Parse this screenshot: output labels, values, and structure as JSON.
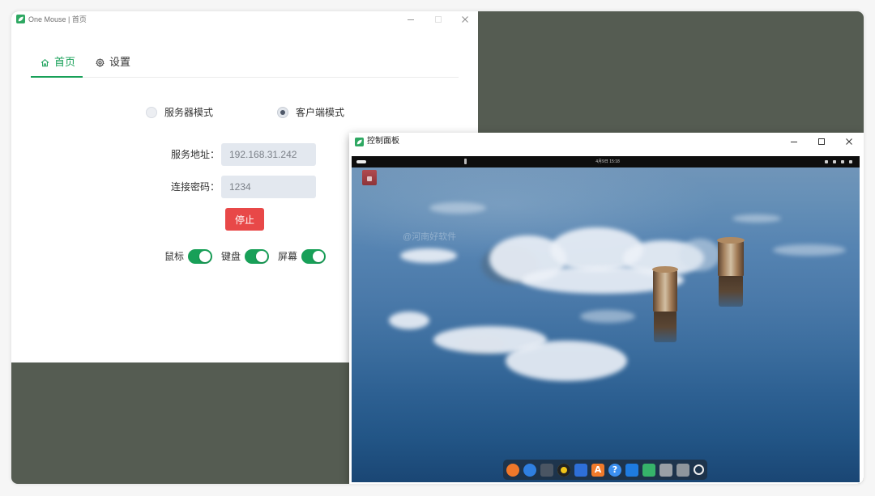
{
  "colors": {
    "accent": "#18a058",
    "danger": "#e84848",
    "desktop_background": "#555c52",
    "input_background": "#e3e8ef"
  },
  "main_window": {
    "title": "One Mouse | 首页",
    "app_icon": "one-mouse-leaf-icon",
    "controls": [
      "minimize-icon",
      "maximize-icon",
      "close-icon"
    ],
    "tabs": [
      {
        "label": "首页",
        "icon": "home-icon",
        "active": true
      },
      {
        "label": "设置",
        "icon": "gear-icon",
        "active": false
      }
    ],
    "mode": {
      "options": [
        {
          "label": "服务器模式",
          "selected": false
        },
        {
          "label": "客户端模式",
          "selected": true
        }
      ]
    },
    "form": {
      "server_address": {
        "label": "服务地址：",
        "value": "192.168.31.242"
      },
      "password": {
        "label": "连接密码：",
        "value": "1234"
      }
    },
    "stop_button": "停止",
    "toggles": [
      {
        "label": "鼠标",
        "on": true
      },
      {
        "label": "键盘",
        "on": true
      },
      {
        "label": "屏幕",
        "on": true
      }
    ]
  },
  "control_panel": {
    "title": "控制面板",
    "app_icon": "one-mouse-leaf-icon",
    "controls": [
      "minimize-icon",
      "maximize-icon",
      "close-icon"
    ],
    "remote_desktop": {
      "top_bar": {
        "clock": "4月9日 15:18",
        "status_icons": [
          {
            "icon": "accessibility-icon"
          },
          {
            "icon": "network-icon"
          },
          {
            "icon": "volume-icon"
          },
          {
            "icon": "power-menu-icon"
          }
        ]
      },
      "desktop_icon": "folder-icon",
      "watermark": "@河南好软件",
      "dock": {
        "items": [
          {
            "icon": "firefox-icon",
            "color": "#f0782a"
          },
          {
            "icon": "browser-icon",
            "color": "#2f7fe0"
          },
          {
            "icon": "file-manager-icon",
            "color": "#4a5563"
          },
          {
            "icon": "music-player-icon",
            "color": "#f0c419"
          },
          {
            "icon": "text-editor-icon",
            "color": "#2e6fd8"
          },
          {
            "icon": "app-store-icon",
            "color": "#f07a2a",
            "glyph": "A"
          },
          {
            "icon": "help-icon",
            "color": "#3b8ff0",
            "glyph": "?"
          },
          {
            "icon": "screenshot-icon",
            "color": "#1e7be0"
          },
          {
            "icon": "one-mouse-icon",
            "color": "#36b36a"
          },
          {
            "icon": "archive-icon",
            "color": "#9aa0a6"
          },
          {
            "icon": "trash-icon",
            "color": "#8f969c"
          },
          {
            "icon": "power-icon"
          }
        ]
      }
    }
  }
}
